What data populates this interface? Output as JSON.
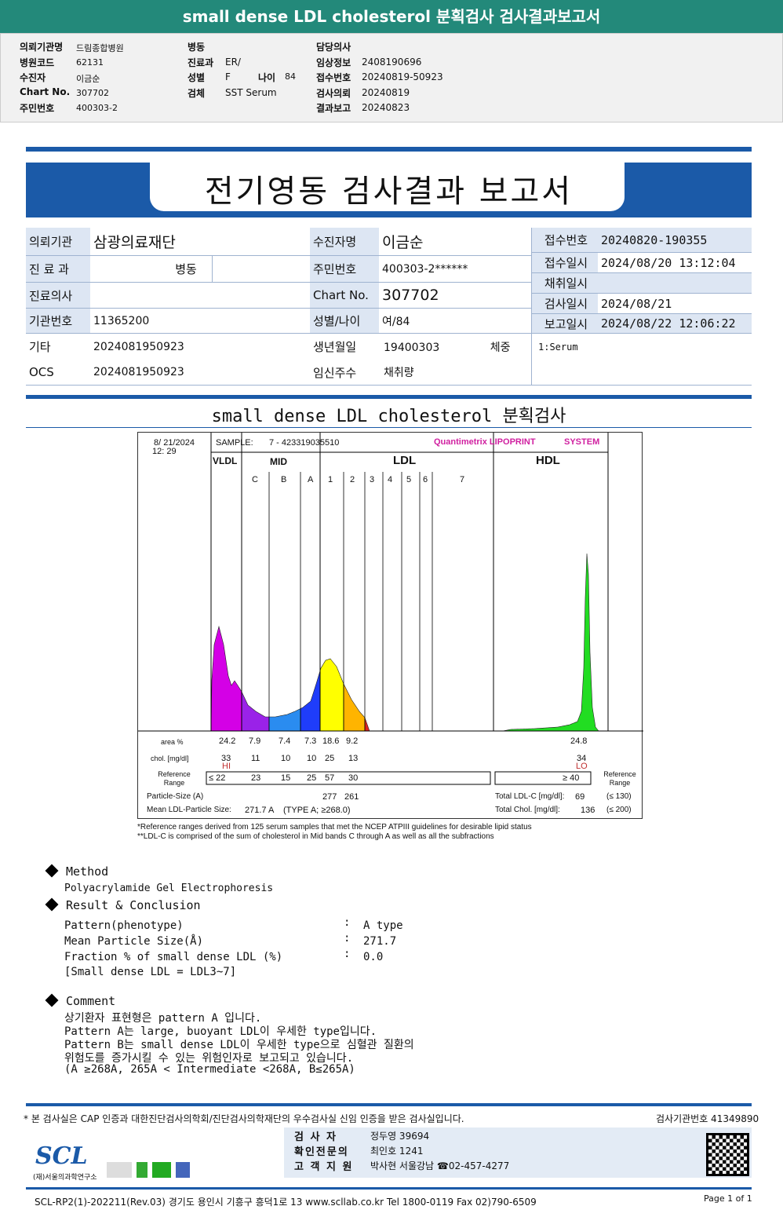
{
  "header": {
    "title": "small dense LDL cholesterol 분획검사 검사결과보고서"
  },
  "info": {
    "col1": [
      [
        "의뢰기관명",
        "드림종합병원"
      ],
      [
        "병원코드",
        "62131"
      ],
      [
        "수진자",
        "이금순"
      ],
      [
        "Chart No.",
        "307702"
      ],
      [
        "주민번호",
        "400303-2"
      ]
    ],
    "col2": [
      [
        "병동",
        ""
      ],
      [
        "진료과",
        "ER/"
      ],
      [
        "성별",
        "F"
      ],
      [
        "검체",
        "SST Serum"
      ]
    ],
    "age_label": "나이",
    "age": "84",
    "col3": [
      [
        "담당의사",
        ""
      ],
      [
        "임상정보",
        "2408190696"
      ],
      [
        "접수번호",
        "20240819-50923"
      ],
      [
        "검사의뢰",
        "20240819"
      ],
      [
        "결과보고",
        "20240823"
      ]
    ]
  },
  "report": {
    "title": "전기영동 검사결과 보고서"
  },
  "table": {
    "l": [
      [
        "의뢰기관",
        "삼광의료재단"
      ],
      [
        "진 료 과",
        ""
      ],
      [
        "진료의사",
        ""
      ],
      [
        "기관번호",
        "11365200"
      ],
      [
        "기타",
        "2024081950923"
      ],
      [
        "OCS",
        "2024081950923"
      ]
    ],
    "ward": "병동",
    "m": [
      [
        "수진자명",
        "이금순"
      ],
      [
        "주민번호",
        "400303-2******"
      ],
      [
        "Chart No.",
        "307702"
      ],
      [
        "성별/나이",
        "여/84"
      ],
      [
        "생년월일",
        "19400303 체중"
      ],
      [
        "임신주수",
        "채취량"
      ]
    ],
    "r": [
      [
        "접수번호",
        "20240820-190355"
      ],
      [
        "접수일시",
        "2024/08/20 13:12:04"
      ],
      [
        "채취일시",
        ""
      ],
      [
        "검사일시",
        "2024/08/21"
      ],
      [
        "보고일시",
        "2024/08/22 12:06:22"
      ]
    ],
    "note": "1:Serum"
  },
  "section_title": "small dense LDL cholesterol 분획검사",
  "chart": {
    "date": "8/ 21/2024",
    "time": "12: 29",
    "sample_label": "SAMPLE:",
    "sample": "7 - 423319035510",
    "brand": "Quantimetrix LIPOPRINT",
    "brand2": "SYSTEM",
    "groups": [
      "VLDL",
      "MID",
      "LDL",
      "HDL"
    ],
    "bands": [
      "C",
      "B",
      "A",
      "1",
      "2",
      "3",
      "4",
      "5",
      "6",
      "7"
    ],
    "row_labels": {
      "area": "area %",
      "chol": "chol. [mg/dl]",
      "ref": "Reference Range",
      "ref_right": "Reference Range",
      "psize": "Particle-Size (A)",
      "mean": "Mean LDL-Particle Size:"
    },
    "area": [
      "24.2",
      "7.9",
      "7.4",
      "7.3",
      "18.6",
      "9.2"
    ],
    "area_hdl": "24.8",
    "chol": [
      "33",
      "11",
      "10",
      "10",
      "25",
      "13"
    ],
    "chol_hdl": "34",
    "flag_vldl": "HI",
    "flag_hdl": "LO",
    "ref": [
      "≤ 22",
      "23",
      "15",
      "25",
      "57",
      "30"
    ],
    "ref_hdl": "≥ 40",
    "psize": [
      "277",
      "261"
    ],
    "mean": "271.7 A",
    "mean_type": "(TYPE A; ≥268.0)",
    "total_ldl_label": "Total LDL-C [mg/dl]:",
    "total_ldl": "69",
    "total_ldl_ref": "(≤ 130)",
    "total_chol_label": "Total Chol. [mg/dl]:",
    "total_chol": "136",
    "total_chol_ref": "(≤ 200)",
    "colors": {
      "vldl": "#d400e6",
      "midc": "#9a22e8",
      "midb": "#2a8cf0",
      "mida": "#1f3dfa",
      "ldl1": "#ffff00",
      "ldl2": "#ffb400",
      "ldl3": "#e02020",
      "hdl": "#22dd22"
    },
    "foot1": "*Reference ranges derived from 125 serum samples that met the NCEP ATPIII guidelines for desirable lipid status",
    "foot2": "**LDL-C is comprised of the sum of cholesterol in Mid bands C through A as well as all the subfractions"
  },
  "method": {
    "title": "Method",
    "text": "Polyacrylamide Gel Electrophoresis"
  },
  "result": {
    "title": "Result & Conclusion",
    "rows": [
      [
        "Pattern(phenotype)",
        ":",
        "A type"
      ],
      [
        "Mean Particle Size(Å)",
        ":",
        "271.7"
      ],
      [
        "Fraction % of small dense LDL (%)",
        ":",
        "0.0"
      ]
    ],
    "note": "[Small dense LDL = LDL3~7]"
  },
  "comment": {
    "title": "Comment",
    "lines": [
      "상기환자 표현형은 pattern A 입니다.",
      "Pattern A는 large, buoyant LDL이 우세한 type입니다.",
      "Pattern B는 small dense LDL이 우세한 type으로 심혈관 질환의",
      "위험도를 증가시킬 수 있는 위험인자로 보고되고 있습니다.",
      "(A ≥268A, 265A < Intermediate <268A, B≤265A)"
    ]
  },
  "footer": {
    "cert": "* 본 검사실은 CAP 인증과 대한진단검사의학회/진단검사의학재단의 우수검사실 신임 인증을 받은 검사실입니다.",
    "inst": "검사기관번호 41349890",
    "staff": [
      [
        "검 사 자",
        "정두영 39694"
      ],
      [
        "확인전문의",
        "최인호 1241"
      ],
      [
        "고 객 지 원",
        "박사현 서울강남 ☎02-457-4277"
      ]
    ],
    "logo": "SCL",
    "logo_sub": "(재)서울의과학연구소",
    "address": "SCL-RP2(1)-202211(Rev.03) 경기도 용인시 기흥구 흥덕1로 13 www.scllab.co.kr Tel 1800-0119 Fax 02)790-6509",
    "page": "Page 1 of 1"
  }
}
